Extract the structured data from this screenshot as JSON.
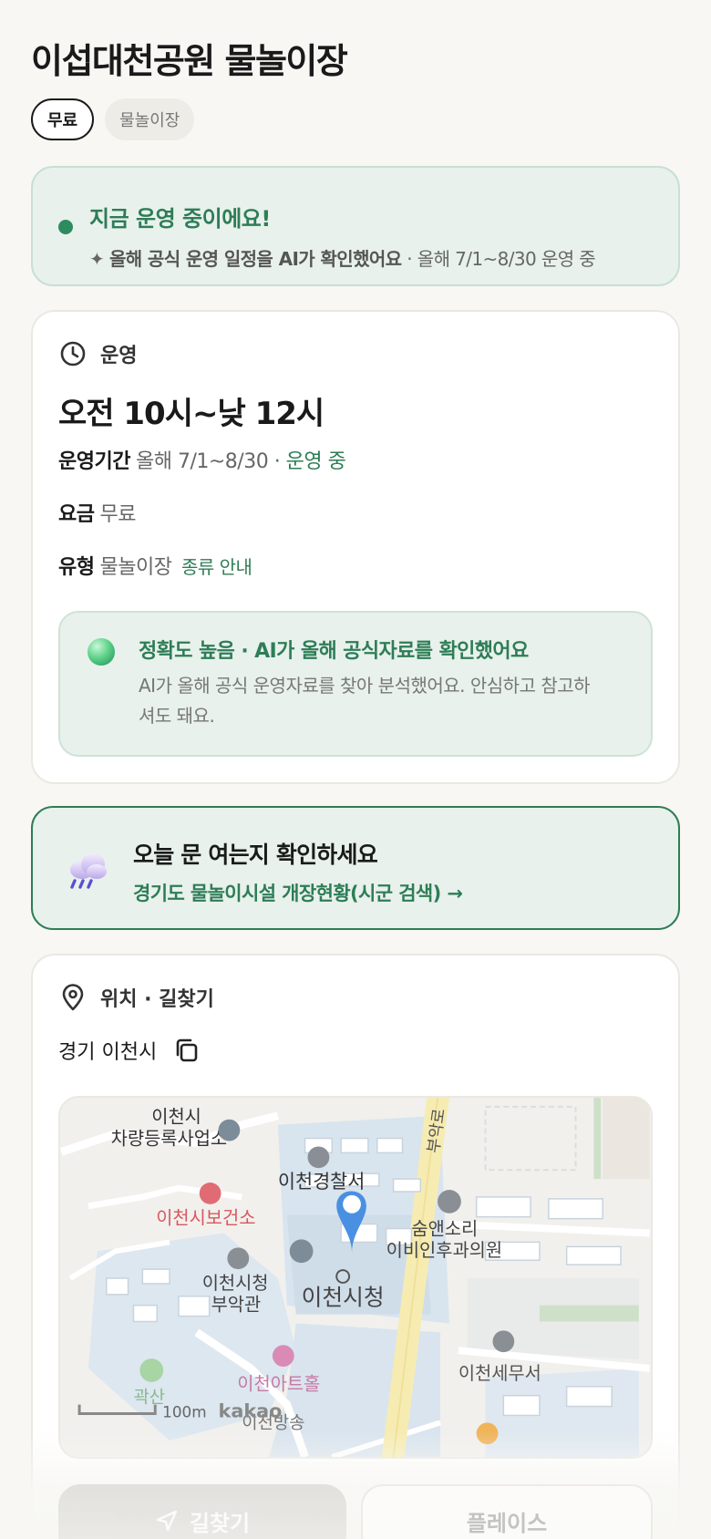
{
  "header": {
    "title": "이섭대천공원 물놀이장",
    "chips": [
      {
        "label": "무료",
        "active": true
      },
      {
        "label": "물놀이장",
        "active": false
      }
    ]
  },
  "status": {
    "headline": "지금 운영 중이에요!",
    "ai_note": "올해 공식 운영 일정을 AI가 확인했어요",
    "period_note": "· 올해 7/1~8/30 운영 중"
  },
  "hours": {
    "section_label": "운영",
    "time": "오전 10시~낮 12시",
    "period_label": "운영기간",
    "period_value": "올해 7/1~8/30",
    "period_status": "· 운영 중",
    "fee_label": "요금",
    "fee_value": "무료",
    "type_label": "유형",
    "type_value": "물놀이장",
    "type_link": "종류 안내",
    "accuracy_title": "정확도 높음 · AI가 올해 공식자료를 확인했어요",
    "accuracy_desc": "AI가 올해 공식 운영자료를 찾아 분석했어요. 안심하고 참고하셔도 돼요."
  },
  "notice": {
    "title": "오늘 문 여는지 확인하세요",
    "link": "경기도 물놀이시설 개장현황(시군 검색) →"
  },
  "location": {
    "section_label": "위치 · 길찾기",
    "address": "경기 이천시",
    "map_labels": {
      "car_registry": "차량등록사업소",
      "city_top": "이천시",
      "police": "이천경찰서",
      "health_center": "이천시보건소",
      "annex": "이천시청",
      "annex_2": "부악관",
      "city_hall": "이천시청",
      "clinic": "숨앤소리",
      "clinic_2": "이비인후과의원",
      "art_hall": "이천아트홀",
      "tax_office": "이천세무서",
      "park": "곽산",
      "road": "부악로",
      "broadcast": "이천방송",
      "scale": "100m",
      "logo": "kakao"
    }
  },
  "actions": {
    "directions_label": "길찾기",
    "place_label": "플레이스"
  },
  "colors": {
    "accent_green": "#2e7d56",
    "status_bg": "#e8f1ec",
    "marker_blue": "#4a90e2"
  }
}
